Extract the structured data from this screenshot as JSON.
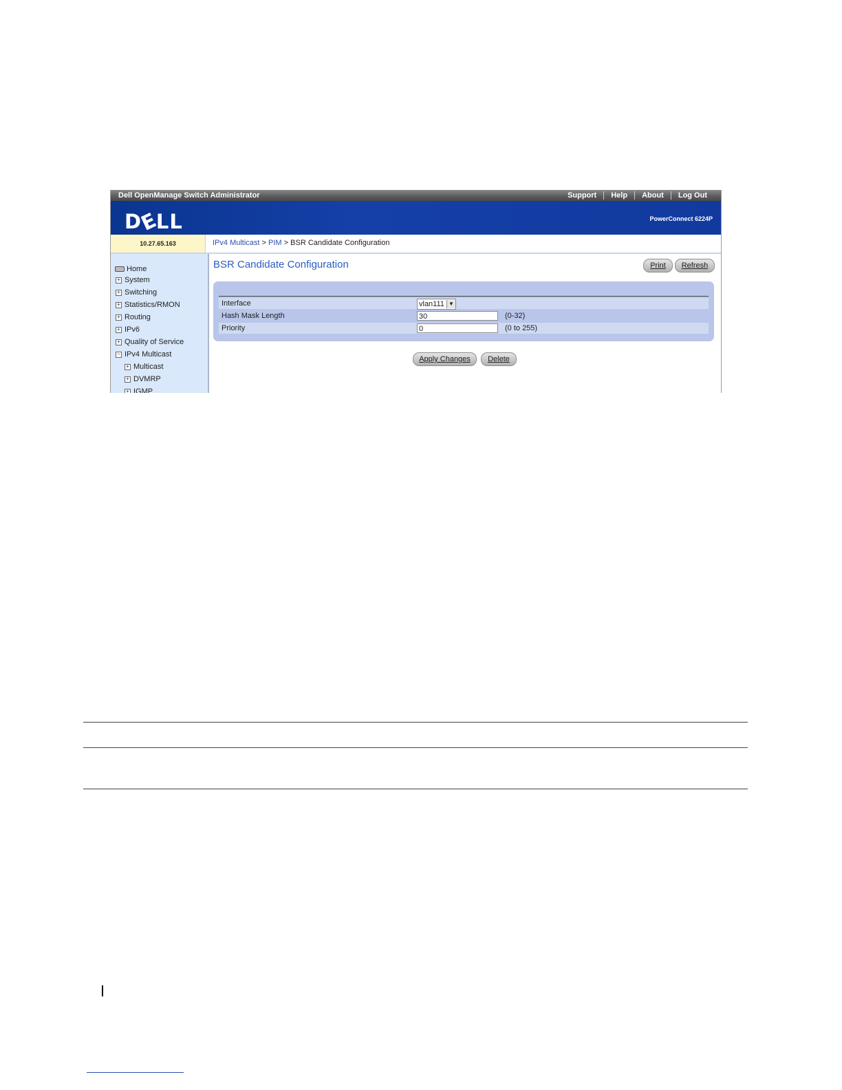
{
  "header": {
    "app_title": "Dell OpenManage Switch Administrator",
    "links": [
      "Support",
      "Help",
      "About",
      "Log Out"
    ],
    "logo_text": "DELL",
    "product": "PowerConnect 6224P"
  },
  "ip_address": "10.27.65.163",
  "breadcrumb": {
    "items": [
      "IPv4 Multicast",
      "PIM",
      "BSR Candidate Configuration"
    ],
    "separator": ">"
  },
  "sidebar": {
    "items": [
      {
        "label": "Home",
        "icon": "drive-icon"
      },
      {
        "label": "System",
        "icon": "plus-icon"
      },
      {
        "label": "Switching",
        "icon": "plus-icon"
      },
      {
        "label": "Statistics/RMON",
        "icon": "plus-icon"
      },
      {
        "label": "Routing",
        "icon": "plus-icon"
      },
      {
        "label": "IPv6",
        "icon": "plus-icon"
      },
      {
        "label": "Quality of Service",
        "icon": "plus-icon"
      },
      {
        "label": "IPv4 Multicast",
        "icon": "minus-icon"
      },
      {
        "label": "Multicast",
        "icon": "plus-icon"
      },
      {
        "label": "DVMRP",
        "icon": "plus-icon"
      },
      {
        "label": "IGMP",
        "icon": "plus-icon"
      }
    ]
  },
  "page": {
    "title": "BSR Candidate Configuration",
    "print_label": "Print",
    "refresh_label": "Refresh"
  },
  "form": {
    "interface": {
      "label": "Interface",
      "value": "vlan111"
    },
    "hash_mask_length": {
      "label": "Hash Mask Length",
      "value": "30",
      "range": "(0-32)"
    },
    "priority": {
      "label": "Priority",
      "value": "0",
      "range": "(0 to 255)"
    }
  },
  "actions": {
    "apply_label": "Apply Changes",
    "delete_label": "Delete"
  },
  "colors": {
    "banner": "#1440a8",
    "title": "#2a5cc0",
    "sidebar": "#d9e8fa",
    "panel": "#b9c6ea"
  }
}
